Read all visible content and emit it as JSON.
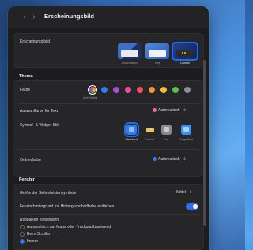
{
  "window": {
    "title": "Erscheinungsbild",
    "back_icon": "chevron-left-icon",
    "forward_icon": "chevron-right-icon"
  },
  "appearance": {
    "label": "Erscheinungsbild",
    "options": [
      {
        "label": "Automatisch",
        "selected": false
      },
      {
        "label": "Hell",
        "selected": false
      },
      {
        "label": "Dunkel",
        "selected": true
      }
    ]
  },
  "theme": {
    "section_title": "Thema",
    "color": {
      "label": "Farbe",
      "selected_caption": "Mehrfarbig",
      "swatches": [
        "#b44cd6",
        "#2f7bf0",
        "#a24fd0",
        "#e24f9a",
        "#ef4f5a",
        "#f5923b",
        "#f2c230",
        "#5fbf4a",
        "#8e8e93"
      ]
    },
    "highlight": {
      "label": "Auswahlfarbe für Text",
      "value": "Automatisch",
      "dot_color": "#e46fb0"
    },
    "icon_style": {
      "label": "Symbol- & Widget-Stil",
      "options": [
        {
          "label": "Standard",
          "selected": true
        },
        {
          "label": "Dunkel",
          "selected": false
        },
        {
          "label": "Klar",
          "selected": false
        },
        {
          "label": "Eingefärbt",
          "selected": false
        }
      ]
    },
    "folder_color": {
      "label": "Ordnerfarbe",
      "value": "Automatisch",
      "dot_color": "#2f7bf0"
    }
  },
  "window_section": {
    "section_title": "Fenster",
    "sidebar_icon_size": {
      "label": "Größe der Seitenleistensymbole",
      "value": "Mittel"
    },
    "tint": {
      "label": "Fensterhintergrund mit Hintergrundbildfarbe einfärben",
      "on": true
    },
    "scrollbars": {
      "label": "Rollbalken einblenden",
      "options": [
        {
          "label": "Automatisch auf Maus oder Trackpad basierend",
          "selected": false
        },
        {
          "label": "Beim Scrollen",
          "selected": false
        },
        {
          "label": "Immer",
          "selected": true
        }
      ]
    }
  },
  "colors": {
    "accent": "#1e6cf0",
    "window_bg": "#1c1c1e",
    "card_bg": "#262628"
  }
}
